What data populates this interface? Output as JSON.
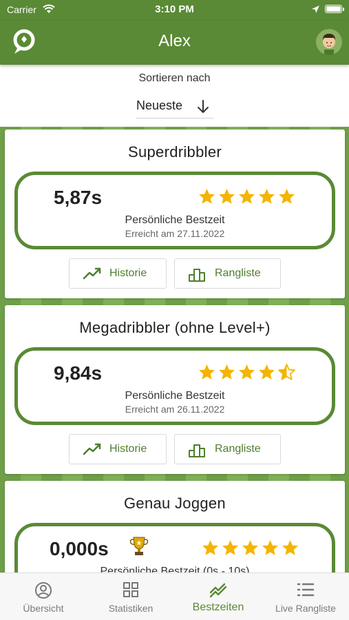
{
  "status_bar": {
    "carrier": "Carrier",
    "time": "3:10 PM"
  },
  "header": {
    "title": "Alex"
  },
  "sort": {
    "label": "Sortieren nach",
    "value": "Neueste"
  },
  "colors": {
    "primary": "#5a8a35",
    "star": "#f5b400",
    "accent_text": "#4d7f2c"
  },
  "cards": [
    {
      "title": "Superdribbler",
      "time": "5,87s",
      "stars": 5,
      "best_label": "Persönliche Bestzeit",
      "date": "Erreicht am 27.11.2022",
      "history_label": "Historie",
      "ranking_label": "Rangliste"
    },
    {
      "title": "Megadribbler (ohne Level+)",
      "time": "9,84s",
      "stars": 4.5,
      "best_label": "Persönliche Bestzeit",
      "date": "Erreicht am 26.11.2022",
      "history_label": "Historie",
      "ranking_label": "Rangliste"
    },
    {
      "title": "Genau Joggen",
      "time": "0,000s",
      "stars": 5,
      "trophy": true,
      "best_label": "Persönliche Bestzeit (0s - 10s)"
    }
  ],
  "tabs": [
    {
      "label": "Übersicht",
      "icon": "person-circle-icon",
      "active": false
    },
    {
      "label": "Statistiken",
      "icon": "grid-icon",
      "active": false
    },
    {
      "label": "Bestzeiten",
      "icon": "trend-icon",
      "active": true
    },
    {
      "label": "Live Rangliste",
      "icon": "list-icon",
      "active": false
    }
  ]
}
